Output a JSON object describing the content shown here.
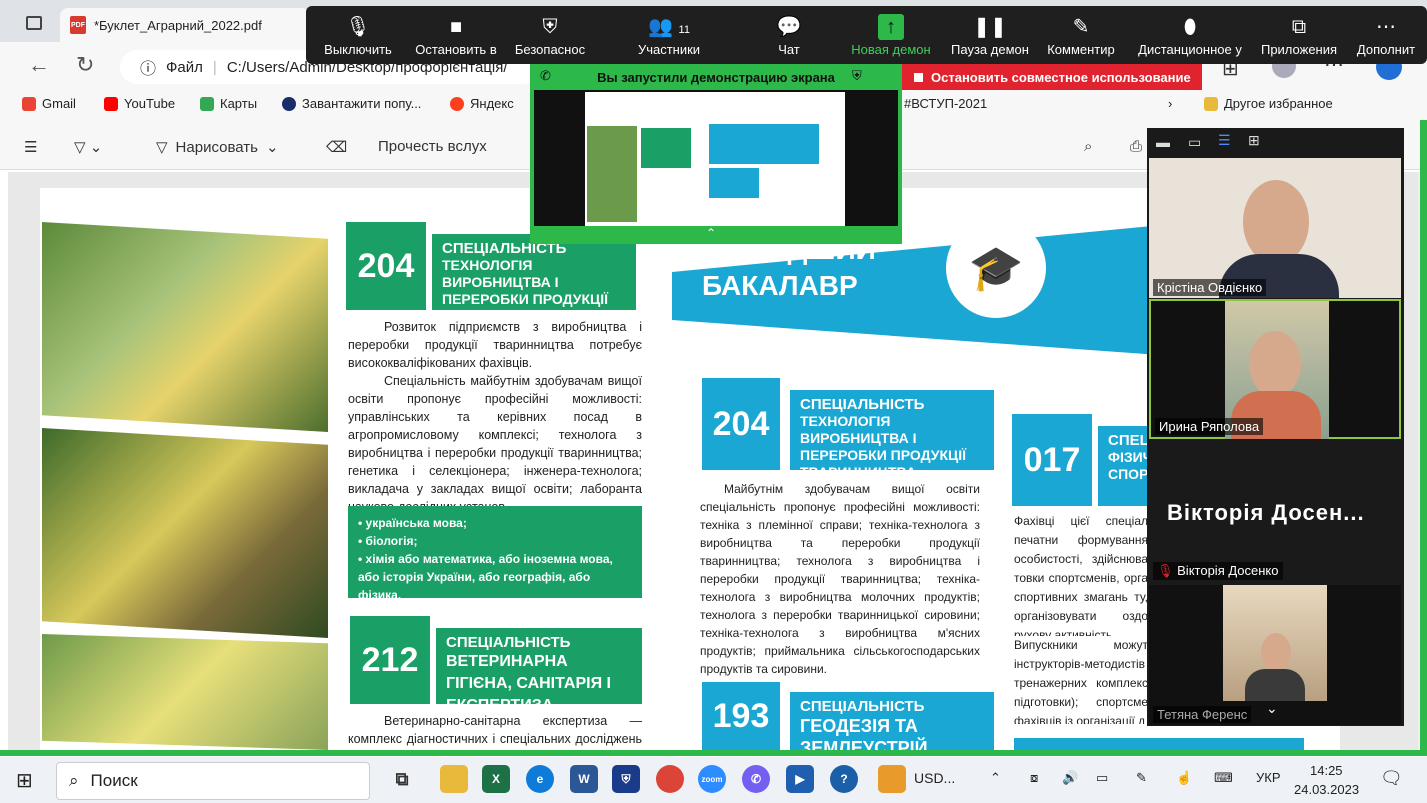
{
  "browser": {
    "tab_title": "*Буклет_Аграрний_2022.pdf",
    "address_prefix": "Файл",
    "address": "C:/Users/Admin/Desktop/профорієнтація/",
    "favorites": [
      "Gmail",
      "YouTube",
      "Карты",
      "Завантажити попу...",
      "Яндекс"
    ],
    "fav_right_tag": "#ВСТУП-2021",
    "fav_other": "Другое избранное"
  },
  "pdf_toolbar": {
    "draw": "Нарисовать",
    "read_aloud": "Прочесть вслух"
  },
  "zoom": {
    "buttons": [
      "Выключить",
      "Остановить в",
      "Безопаснос",
      "Участники",
      "Чат",
      "Новая демон",
      "Пауза демон",
      "Комментир",
      "Дистанционное у",
      "Приложения",
      "Дополнит"
    ],
    "participants_count": "11",
    "sharing_notice": "Вы запустили демонстрацию экрана",
    "stop_share": "Остановить совместное использование",
    "participants": [
      "Крістіна Овдієнко",
      "Ирина Ряполова",
      "Вікторія Досенко",
      "Тетяна Ференс"
    ],
    "big_name": "Вікторія  Досен...",
    "accent": "#2db84a"
  },
  "doc": {
    "left_col": {
      "block1_num": "204",
      "block1_head": "СПЕЦІАЛЬНІСТЬ",
      "block1_title": "ТЕХНОЛОГІЯ ВИРОБНИЦТВА І ПЕРЕРОБКИ ПРОДУКЦІЇ ТВАРИННИЦТВА",
      "block1_p1": "Розвиток підприємств з виробництва і переробки продукції тваринництва потребує висококваліфікованих фахівців.",
      "block1_p2": "Спеціальність майбутнім здобувачам вищої освіти пропонує професійні можливості: управлінських та керівних посад в агропромисловому комплексі; технолога з виробництва і переробки продукції тваринництва; генетика і селекціонера; інженера-технолога; викладача у закладах вищої освіти; лаборанта науково-дослідних установ.",
      "subjects": [
        "• українська мова;",
        "• біологія;",
        "• хімія або математика, або іноземна мова, або історія України, або географія, або фізика."
      ],
      "block2_num": "212",
      "block2_head": "СПЕЦІАЛЬНІСТЬ",
      "block2_title": "ВЕТЕРИНАРНА ГІГІЄНА, САНІТАРІЯ І ЕКСПЕРТИЗА",
      "block2_p1": "Ветеринарно-санітарна експертиза — комплекс діагностичних і спеціальних досліджень з ме-"
    },
    "right_col": {
      "banner": "МОЛОДШИЙ БАКАЛАВР",
      "block1_num": "204",
      "block1_head": "СПЕЦІАЛЬНІСТЬ",
      "block1_title": "ТЕХНОЛОГІЯ ВИРОБНИЦТВА І ПЕРЕРОБКИ ПРОДУКЦІЇ ТВАРИННИЦТВА",
      "block1_p1": "Майбутнім здобувачам вищої освіти спеціальність пропонує професійні можливості: техніка з племінної справи; техніка-технолога з виробництва та переробки продукції тваринництва; технолога з виробництва і переробки продукції тваринництва; техніка-технолога з виробництва молочних продуктів; технолога з переробки тваринницької сировини; техніка-технолога з виробництва м'ясних продуктів; приймальника сільськогосподарських продуктів та сировини.",
      "block2_num": "017",
      "block2_head": "СПЕЦІ",
      "block2_title": "ФІЗИЧ СПОРТ",
      "block2_p1": "Фахівці цієї спеціал печатни формування особистості, здійснюва товки спортсменів, орга спортивних змагань ту, організовувати оздо рухову активність.",
      "block2_p2": "Випускники можут інструкторів-методистів тренажерних комплекс підготовки); спортсме фахівців із організації д",
      "block3_num": "193",
      "block3_head": "СПЕЦІАЛЬНІСТЬ",
      "block3_title": "ГЕОДЕЗІЯ ТА ЗЕМЛЕУСТРІЙ"
    }
  },
  "taskbar": {
    "search": "Поиск",
    "app_text": "USD...",
    "lang": "УКР",
    "time": "14:25",
    "date": "24.03.2023"
  }
}
